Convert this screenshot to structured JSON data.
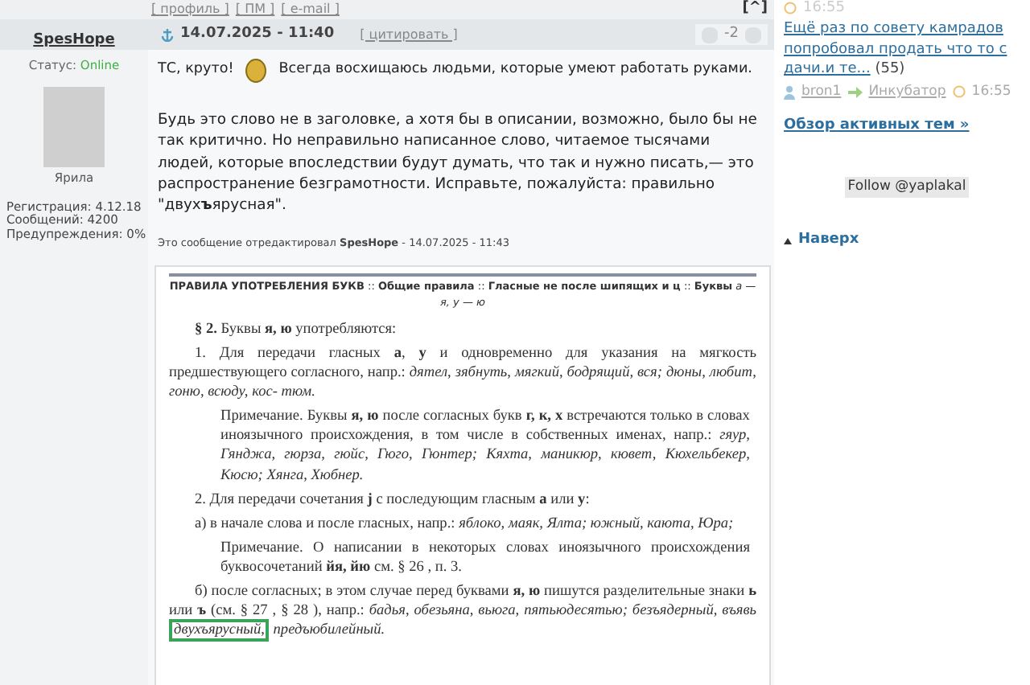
{
  "top_links": [
    "[ профиль ]",
    "[ ПМ ]",
    "[ e-mail ]"
  ],
  "top_button": "[^]",
  "post": {
    "author": "SpesHope",
    "date": "14.07.2025 - 11:40",
    "quote_link": "[ цитировать ]",
    "rating": "-2",
    "status_label": "Статус:",
    "status": "Online",
    "avatar_caption": "Ярила",
    "author_stats": [
      "Регистрация: 4.12.18",
      "Сообщений: 4200",
      "Предупреждения: 0%"
    ],
    "first_line_before": "ТС, круто!",
    "first_line_after": "Всегда восхищаюсь людьми, которые умеют работать руками.",
    "paragraph": "Будь это слово не в заголовке, а хотя бы в описании, возможно, было бы не так критично. Но неправильно написанное слово, читаемое тысячами людей, которые впоследствии будут думать, что так и нужно писать,— это распространение безграмотности. Исправьте, пожалуйста: правильно \"двух**ъ**ярусная\".",
    "edit_note": "Это сообщение отредактировал **SpesHope** - 14.07.2025 - 11:43"
  },
  "document": {
    "breadcrumb": "**ПРАВИЛА УПОТРЕБЛЕНИЯ БУКВ** :: **Общие правила** :: **Гласные не после шипящих и ц** :: **Буквы** *а — я, у — ю*",
    "paragraphs": [
      {
        "kind": "heading",
        "text": "**§ 2.** Буквы **я, ю** употребляются:"
      },
      {
        "kind": "item",
        "text": "1. Для передачи гласных **а**, **у** и одновременно для указания на мягкость предшествующего согласного, напр.: *дятел, зябнуть, мягкий, бодрящий, вся; дюны, любит, гоню, всюду, кос- тюм.*"
      },
      {
        "kind": "note",
        "text": "Примечание. Буквы **я, ю** после согласных букв **г, к, х** встречаются только в словах иноязычного происхождения, в том числе в собственных именах, напр.: *гяур, Гянджа, гюрза, гюйс, Гюго, Гюнтер; Кяхта, маникюр, кювет, Кюхельбекер, Кюсю; Хянга, Хюбнер.*"
      },
      {
        "kind": "item",
        "text": "2. Для передачи сочетания **j** с последующим гласным **а** или **у**:"
      },
      {
        "kind": "item",
        "text": "а) в начале слова и после гласных, напр.: *яблоко, маяк, Ялта; южный, каюта, Юра;*"
      },
      {
        "kind": "note",
        "text": "Примечание. О написании в некоторых словах иноязычного происхождения буквосочетаний **йя, йю** см. § 26 , п. 3."
      },
      {
        "kind": "item",
        "text": "б) после согласных; в этом случае перед буквами **я, ю** пишутся разделительные знаки **ь** или **ъ** (см. § 27 , § 28 ), напр.: *бадья, обезьяна, вьюга, пятьюдесятью; безъядерный, въявь*",
        "highlighted": "двухъярусный,",
        "text_after": "*предъюбилейный.*"
      }
    ]
  },
  "sidebar": {
    "time_top": "16:55",
    "topic_link": "Ещё раз по совету камрадов попробовал продать что то с дачи.и те...",
    "topic_count": "(55)",
    "topic_user": "bron1",
    "topic_forum": "Инкубатор",
    "topic_time": "16:55",
    "overview_link": "Обзор активных тем »",
    "follow": "Follow @yaplakal",
    "back_top": "Наверх"
  }
}
